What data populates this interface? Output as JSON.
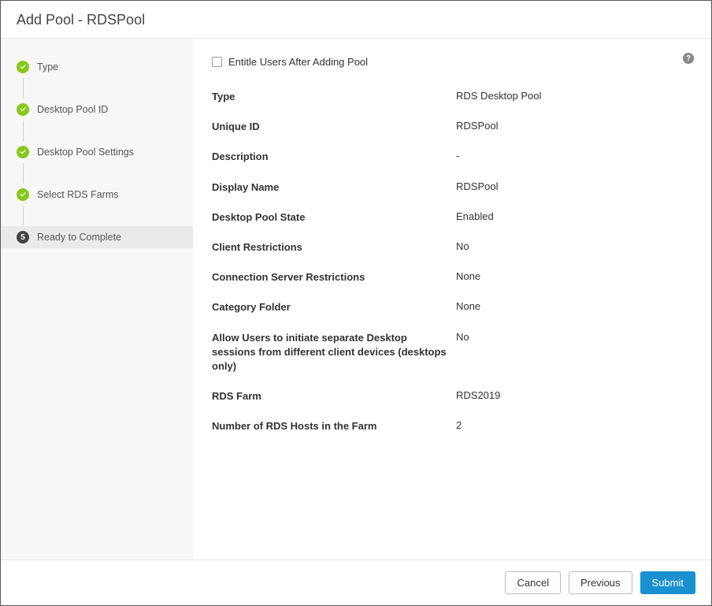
{
  "dialog": {
    "title": "Add Pool - RDSPool"
  },
  "wizard": {
    "steps": [
      {
        "label": "Type",
        "state": "done"
      },
      {
        "label": "Desktop Pool ID",
        "state": "done"
      },
      {
        "label": "Desktop Pool Settings",
        "state": "done"
      },
      {
        "label": "Select RDS Farms",
        "state": "done"
      },
      {
        "label": "Ready to Complete",
        "state": "current",
        "num": "5"
      }
    ]
  },
  "content": {
    "entitle_checkbox_label": "Entitle Users After Adding Pool",
    "entitle_checked": false,
    "rows": [
      {
        "label": "Type",
        "value": "RDS Desktop Pool"
      },
      {
        "label": "Unique ID",
        "value": "RDSPool"
      },
      {
        "label": "Description",
        "value": "-"
      },
      {
        "label": "Display Name",
        "value": "RDSPool"
      },
      {
        "label": "Desktop Pool State",
        "value": "Enabled"
      },
      {
        "label": "Client Restrictions",
        "value": "No"
      },
      {
        "label": "Connection Server Restrictions",
        "value": "None"
      },
      {
        "label": "Category Folder",
        "value": "None"
      },
      {
        "label": "Allow Users to initiate separate Desktop sessions from different client devices (desktops only)",
        "value": "No"
      },
      {
        "label": "RDS Farm",
        "value": "RDS2019"
      },
      {
        "label": "Number of RDS Hosts in the Farm",
        "value": "2"
      }
    ]
  },
  "footer": {
    "cancel": "Cancel",
    "previous": "Previous",
    "submit": "Submit"
  },
  "help_glyph": "?"
}
